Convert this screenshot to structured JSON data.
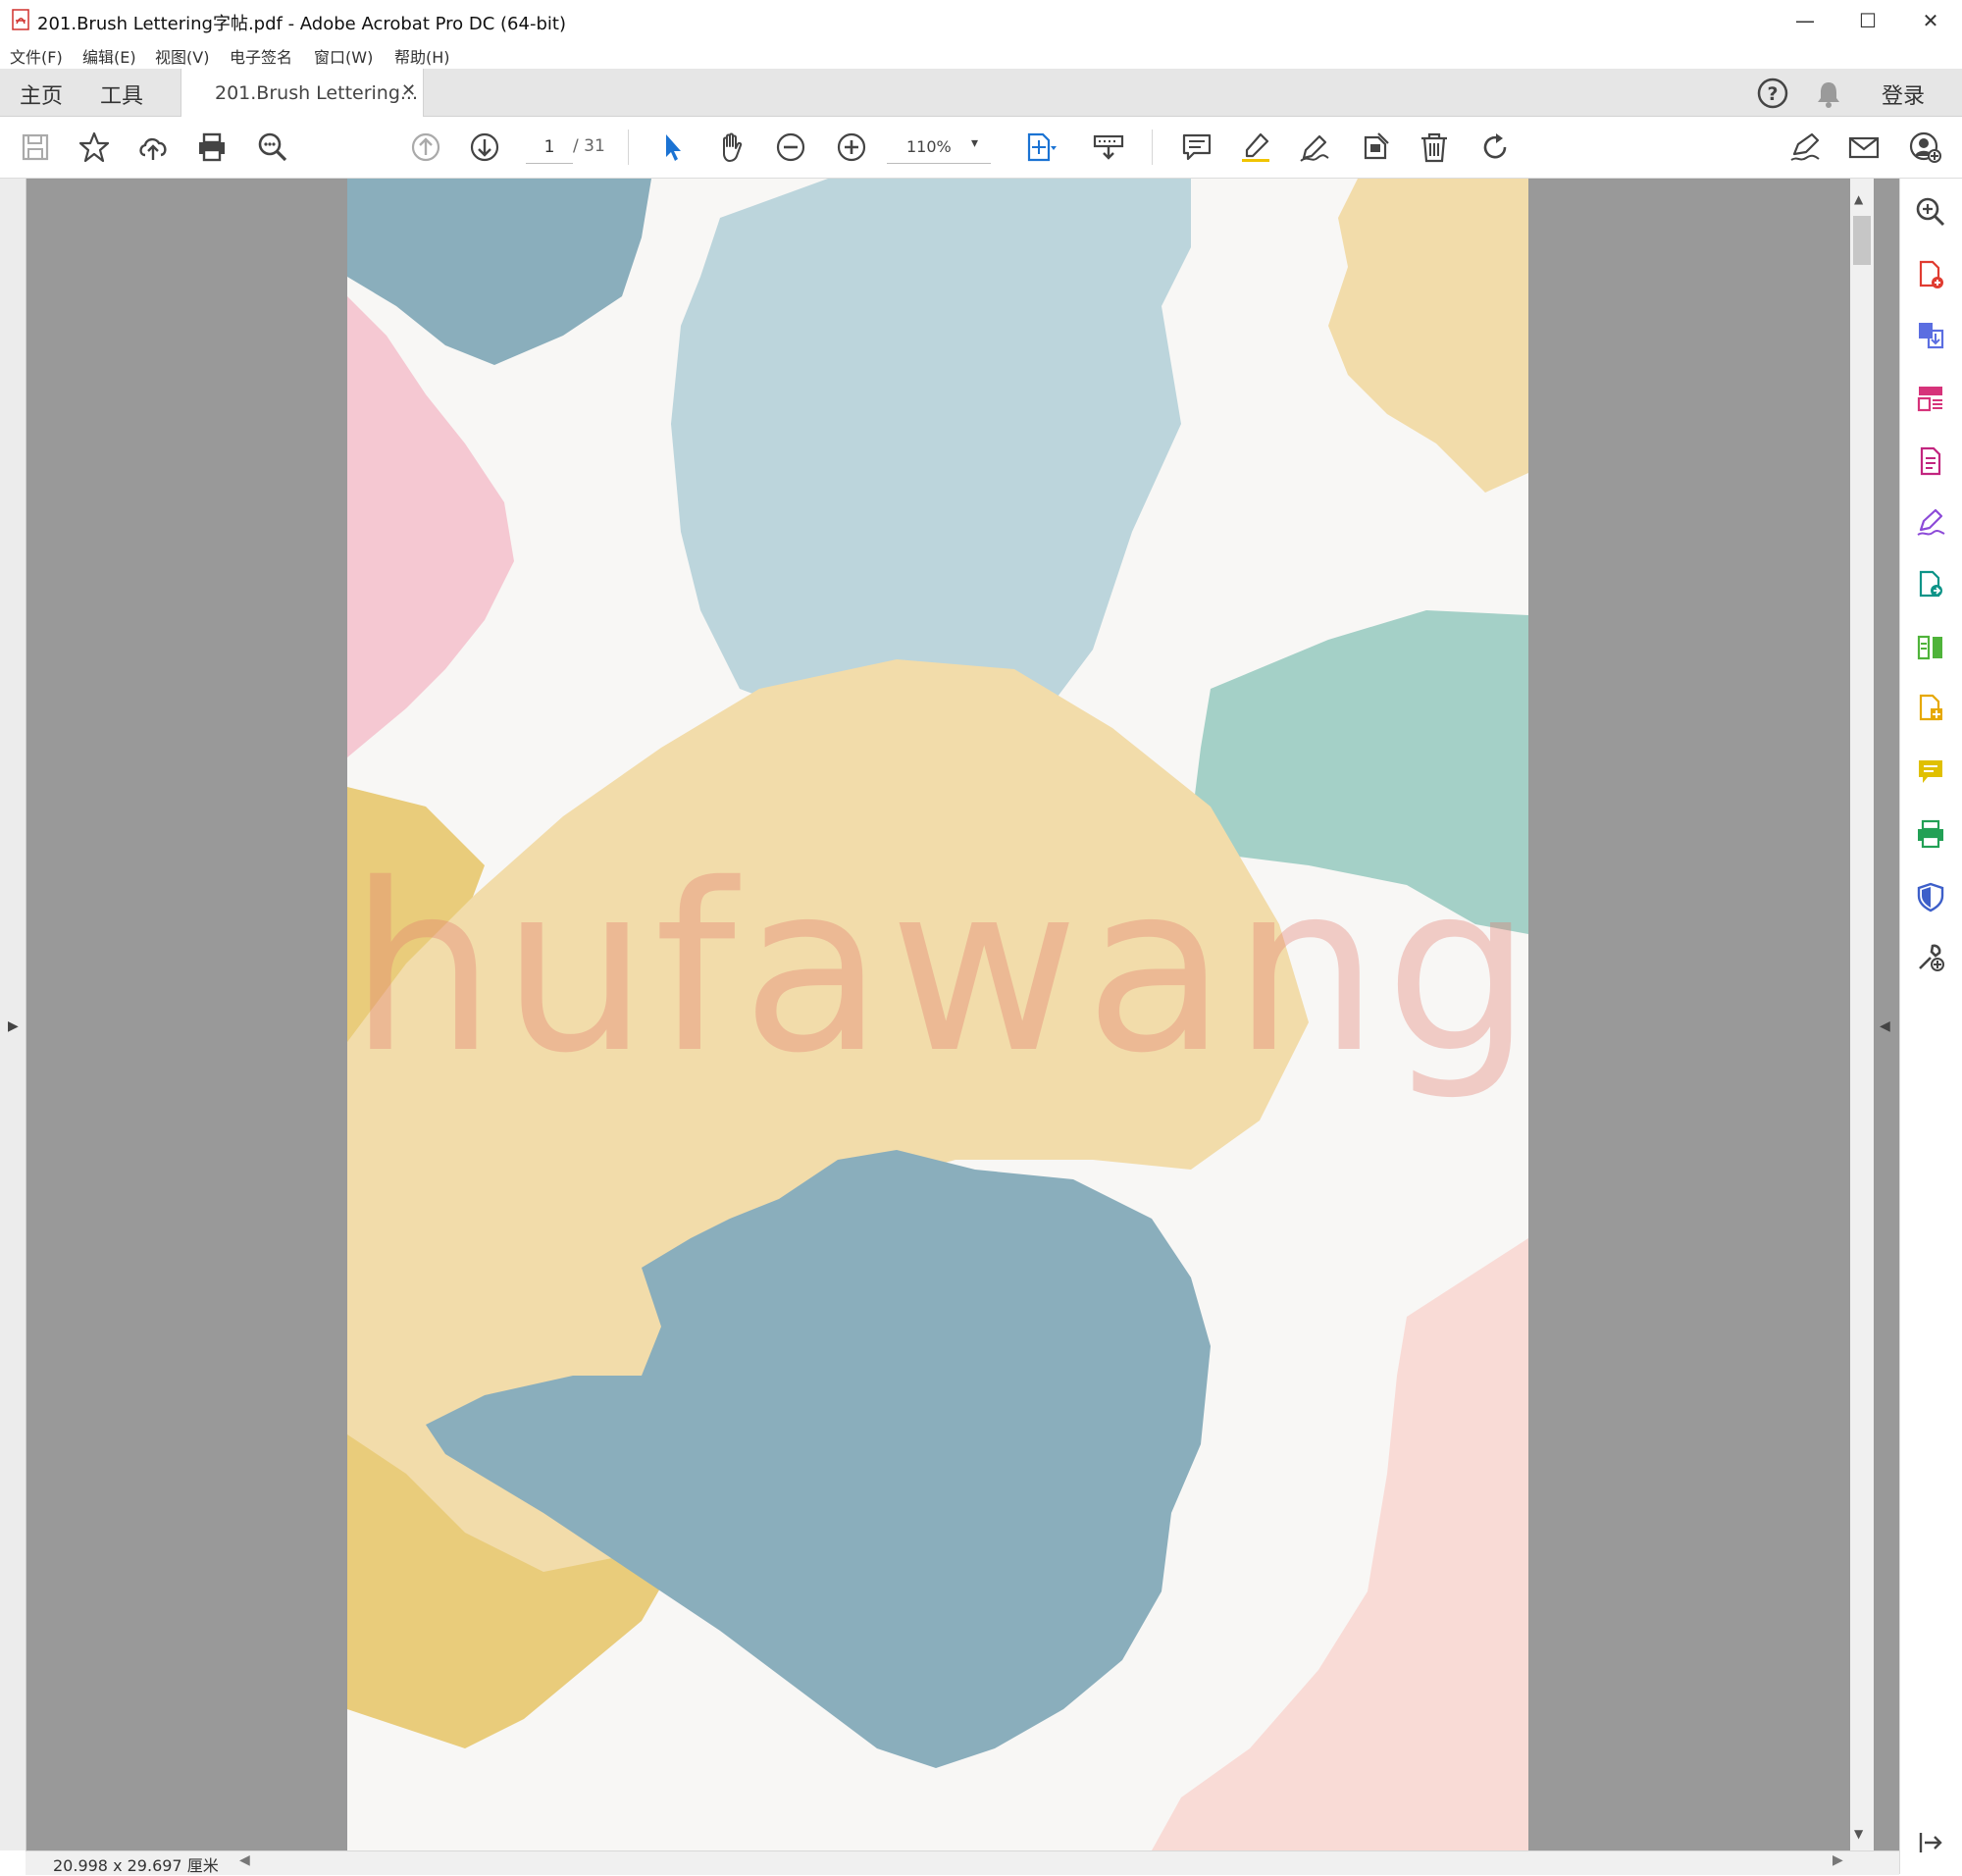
{
  "window": {
    "title": "201.Brush Lettering字帖.pdf - Adobe Acrobat Pro DC (64-bit)",
    "minimize": "—",
    "maximize": "☐",
    "close": "✕"
  },
  "menu": {
    "items": [
      "文件(F)",
      "编辑(E)",
      "视图(V)",
      "电子签名",
      "窗口(W)",
      "帮助(H)"
    ]
  },
  "tabs": {
    "home": "主页",
    "tools": "工具",
    "document": "201.Brush Lettering...",
    "close": "✕",
    "login": "登录"
  },
  "toolbar": {
    "page_current": "1",
    "page_total": "/ 31",
    "zoom": "110%",
    "zoom_caret": "▾"
  },
  "document": {
    "watermark": "Shufawang.CN",
    "page_size": "20.998 x 29.697 厘米"
  },
  "icons": {
    "toolbar_left": [
      "save-icon",
      "star-icon",
      "cloud-upload-icon",
      "print-icon",
      "zoom-search-icon"
    ],
    "navigation": [
      "page-up-icon",
      "page-down-icon"
    ],
    "toolbar_middle": [
      "select-arrow-icon",
      "hand-icon",
      "zoom-out-icon",
      "zoom-in-icon",
      "fit-page-icon",
      "keyboard-icon"
    ],
    "toolbar_annot": [
      "comment-icon",
      "highlighter-icon",
      "sign-pen-icon",
      "stamp-icon",
      "delete-icon",
      "rotate-icon"
    ],
    "toolbar_right": [
      "fill-sign-icon",
      "mail-icon",
      "share-user-icon"
    ],
    "right_panel": [
      "zoom-tool-icon",
      "create-pdf-icon",
      "export-pdf-icon",
      "organize-pages-icon",
      "edit-pdf-icon",
      "fill-sign-panel-icon",
      "send-review-icon",
      "compare-icon",
      "combine-icon",
      "comment-panel-icon",
      "print-production-icon",
      "protect-icon",
      "more-tools-icon",
      "expand-panel-icon"
    ]
  },
  "colors": {
    "accent_blue": "#1b73d3",
    "page_bg": "#f8f7f5",
    "gray_area": "#999999",
    "brush_blue": "#8aaebc",
    "brush_lightblue": "#bcd5dc",
    "brush_sand": "#f2dcaa",
    "brush_gold": "#e9cc7b",
    "brush_mint": "#a4d0c7",
    "brush_pink": "#f5c8d2",
    "brush_peach": "#f9dbd6",
    "watermark": "#e2786e"
  }
}
